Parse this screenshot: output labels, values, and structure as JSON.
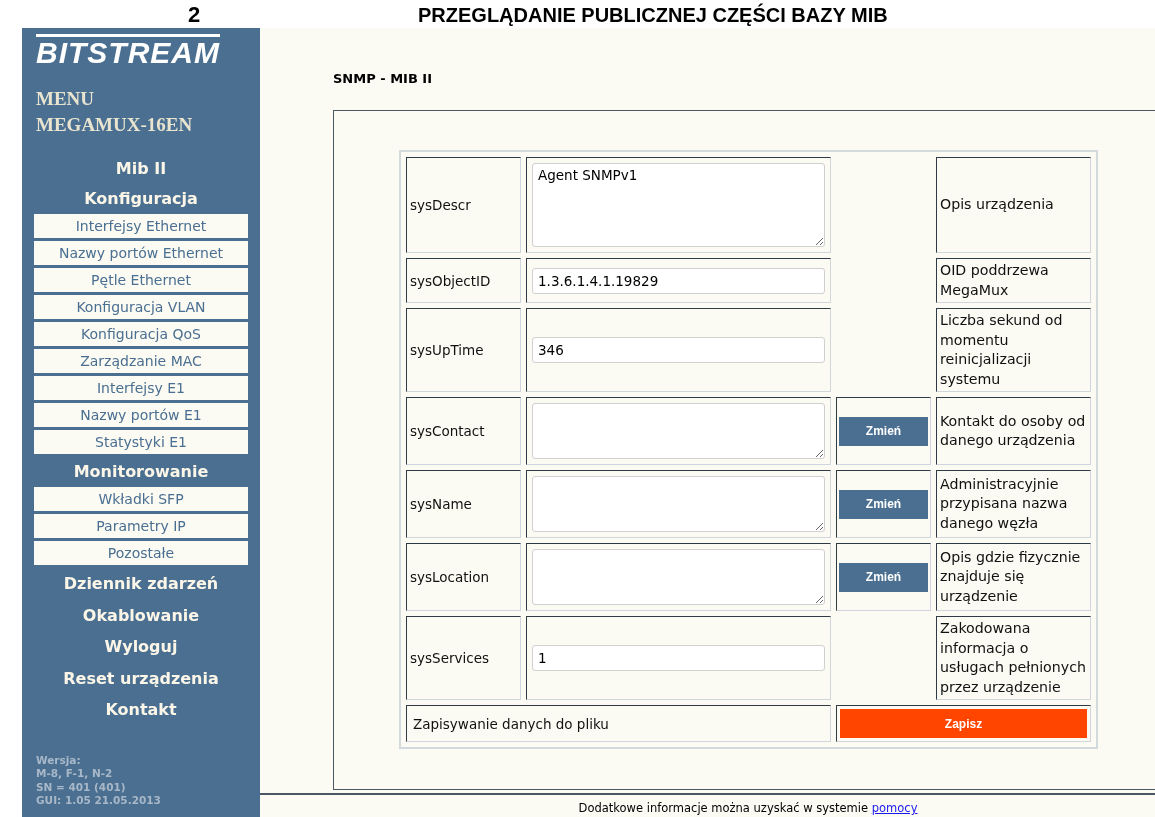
{
  "header": {
    "number": "2",
    "title": "PRZEGLĄDANIE PUBLICZNEJ CZĘŚCI BAZY MIB"
  },
  "sidebar": {
    "logo": "BITSTREAM",
    "menu_title": [
      "MENU",
      "MEGAMUX-16EN"
    ],
    "items": [
      {
        "kind": "section",
        "label": "Mib II"
      },
      {
        "kind": "section",
        "label": "Konfiguracja"
      },
      {
        "kind": "link",
        "label": "Interfejsy Ethernet"
      },
      {
        "kind": "link",
        "label": "Nazwy portów Ethernet"
      },
      {
        "kind": "link",
        "label": "Pętle Ethernet"
      },
      {
        "kind": "link",
        "label": "Konfiguracja VLAN"
      },
      {
        "kind": "link",
        "label": "Konfiguracja QoS"
      },
      {
        "kind": "link",
        "label": "Zarządzanie MAC"
      },
      {
        "kind": "link",
        "label": "Interfejsy E1"
      },
      {
        "kind": "link",
        "label": "Nazwy portów E1"
      },
      {
        "kind": "link",
        "label": "Statystyki E1"
      },
      {
        "kind": "section",
        "label": "Monitorowanie"
      },
      {
        "kind": "link",
        "label": "Wkładki SFP"
      },
      {
        "kind": "link",
        "label": "Parametry IP"
      },
      {
        "kind": "link",
        "label": "Pozostałe"
      },
      {
        "kind": "section",
        "label": "Dziennik zdarzeń"
      },
      {
        "kind": "section",
        "label": "Okablowanie"
      },
      {
        "kind": "section",
        "label": "Wyloguj"
      },
      {
        "kind": "section",
        "label": "Reset urządzenia"
      },
      {
        "kind": "section",
        "label": "Kontakt"
      }
    ],
    "version": [
      "Wersja:",
      "M-8, F-1, N-2",
      "SN = 401 (401)",
      "GUI: 1.05 21.05.2013"
    ]
  },
  "page_title": "SNMP - MIB II",
  "rows": [
    {
      "name": "sysDescr",
      "kind": "memo",
      "value": "Agent SNMPv1",
      "description": "Opis urządzenia"
    },
    {
      "name": "sysObjectID",
      "kind": "input",
      "value": "1.3.6.1.4.1.19829",
      "description": "OID poddrzewa MegaMux"
    },
    {
      "name": "sysUpTime",
      "kind": "input",
      "value": "346",
      "description": "Liczba sekund od momentu reinicjalizacji systemu"
    },
    {
      "name": "sysContact",
      "kind": "textarea",
      "button": "Zmień",
      "description": "Kontakt do osoby od danego urządzenia"
    },
    {
      "name": "sysName",
      "kind": "textarea",
      "button": "Zmień",
      "description": "Administracyjnie przypisana nazwa danego węzła"
    },
    {
      "name": "sysLocation",
      "kind": "textarea",
      "button": "Zmień",
      "description": "Opis gdzie fizycznie znajduje się urządzenie"
    },
    {
      "name": "sysServices",
      "kind": "input",
      "value": "1",
      "description": "Zakodowana informacja o usługach pełnionych przez urządzenie"
    }
  ],
  "save_row": {
    "label": "Zapisywanie danych do pliku",
    "button": "Zapisz"
  },
  "footer": {
    "text": "Dodatkowe informacje można uzyskać w systemie",
    "link": "pomocy"
  }
}
